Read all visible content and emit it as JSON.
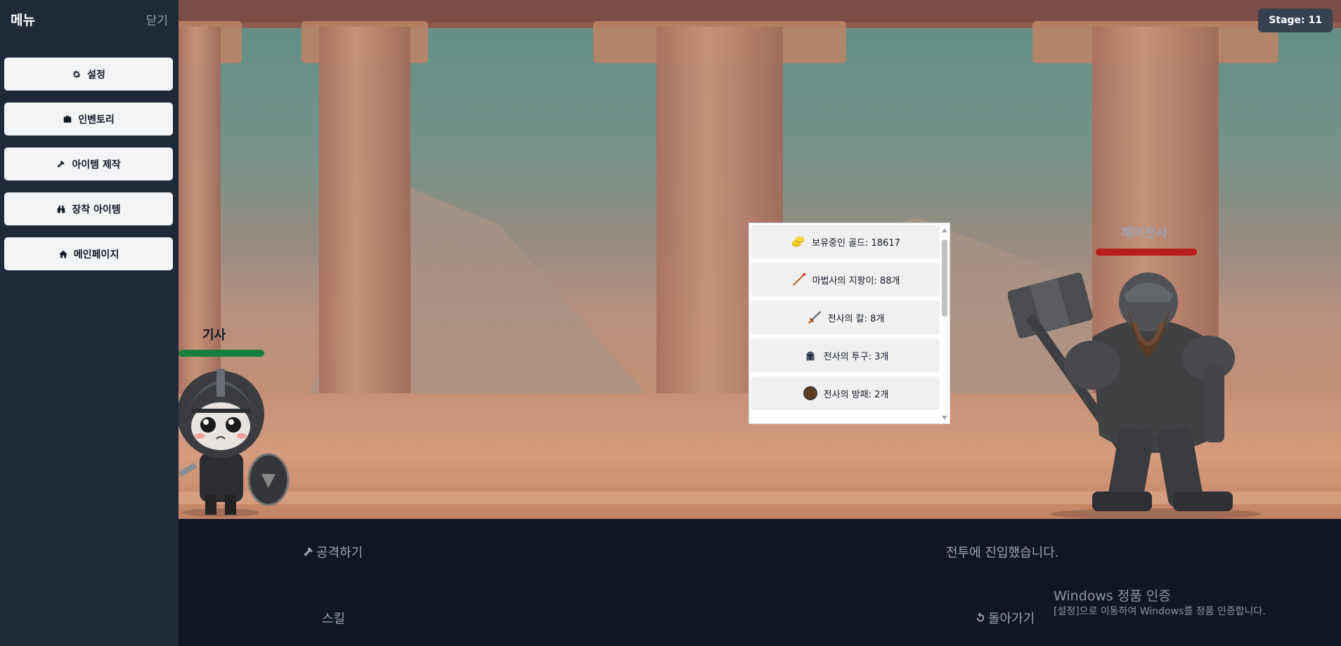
{
  "sidebar": {
    "title": "메뉴",
    "close_label": "닫기",
    "items": [
      {
        "label": "설정",
        "icon": "gear-icon"
      },
      {
        "label": "인벤토리",
        "icon": "briefcase-icon"
      },
      {
        "label": "아이템 제작",
        "icon": "hammer-icon"
      },
      {
        "label": "장착 아이템",
        "icon": "binoculars-icon"
      },
      {
        "label": "메인페이지",
        "icon": "home-icon"
      }
    ]
  },
  "stage": {
    "label": "Stage: 11"
  },
  "player": {
    "name": "기사",
    "hp_fraction": 1.0,
    "hp_color": "#15803d"
  },
  "enemy": {
    "name": "해머전사",
    "hp_fraction": 1.0,
    "hp_color": "#b91c1c"
  },
  "inventory": {
    "items": [
      {
        "label": "보유중인 골드: 18617",
        "icon": "gold-coins-icon"
      },
      {
        "label": "마법사의 지팡이: 88개",
        "icon": "wizard-staff-icon"
      },
      {
        "label": "전사의 칼: 8개",
        "icon": "sword-icon"
      },
      {
        "label": "전사의 투구: 3개",
        "icon": "helmet-icon"
      },
      {
        "label": "전사의 방패: 2개",
        "icon": "shield-icon"
      }
    ]
  },
  "actions": {
    "attack": "공격하기",
    "skill": "스킬",
    "back": "돌아가기"
  },
  "battle_log": "전투에 진입했습니다.",
  "windows_activation": {
    "title": "Windows 정품 인증",
    "subtitle": "[설정]으로 이동하여 Windows를 정품 인증합니다."
  },
  "colors": {
    "sidebar_bg": "#1f2937",
    "bottom_bg": "#111722",
    "button_bg": "#f3f4f6"
  }
}
